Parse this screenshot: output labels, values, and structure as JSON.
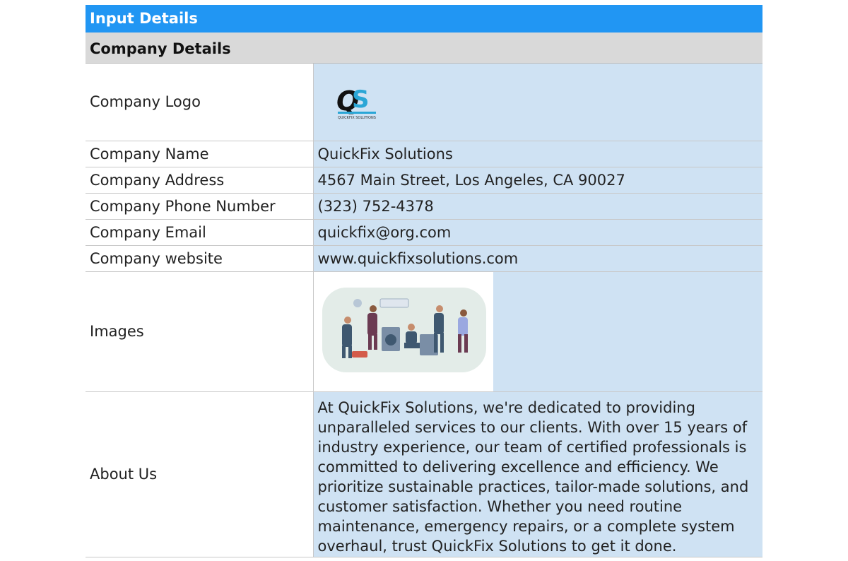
{
  "header": {
    "title": "Input Details"
  },
  "section": {
    "title": "Company Details"
  },
  "rows": {
    "logo": {
      "label": "Company Logo",
      "logo_alt": "QuickFix Solutions logo",
      "logo_wordmark": "QUICKFIX SOLUTIONS"
    },
    "name": {
      "label": "Company Name",
      "value": "QuickFix Solutions"
    },
    "address": {
      "label": "Company Address",
      "value": "4567 Main Street, Los Angeles, CA 90027"
    },
    "phone": {
      "label": "Company Phone Number",
      "value": "(323) 752-4378"
    },
    "email": {
      "label": "Company Email",
      "value": "quickfix@org.com"
    },
    "website": {
      "label": "Company website",
      "value": "www.quickfixsolutions.com"
    },
    "images": {
      "label": "Images",
      "image_alt": "Illustration of technicians repairing appliances"
    },
    "about": {
      "label": "About Us",
      "value": "At QuickFix Solutions, we're dedicated to providing unparalleled services to our clients. With over 15 years of industry experience, our team of certified professionals is committed to delivering excellence and efficiency. We prioritize sustainable practices, tailor-made solutions, and customer satisfaction. Whether you need routine maintenance, emergency repairs, or a complete system overhaul, trust QuickFix Solutions to get it done."
    }
  },
  "colors": {
    "header_bg": "#2196f3",
    "section_bg": "#d9d9d9",
    "value_bg": "#cfe2f3"
  }
}
